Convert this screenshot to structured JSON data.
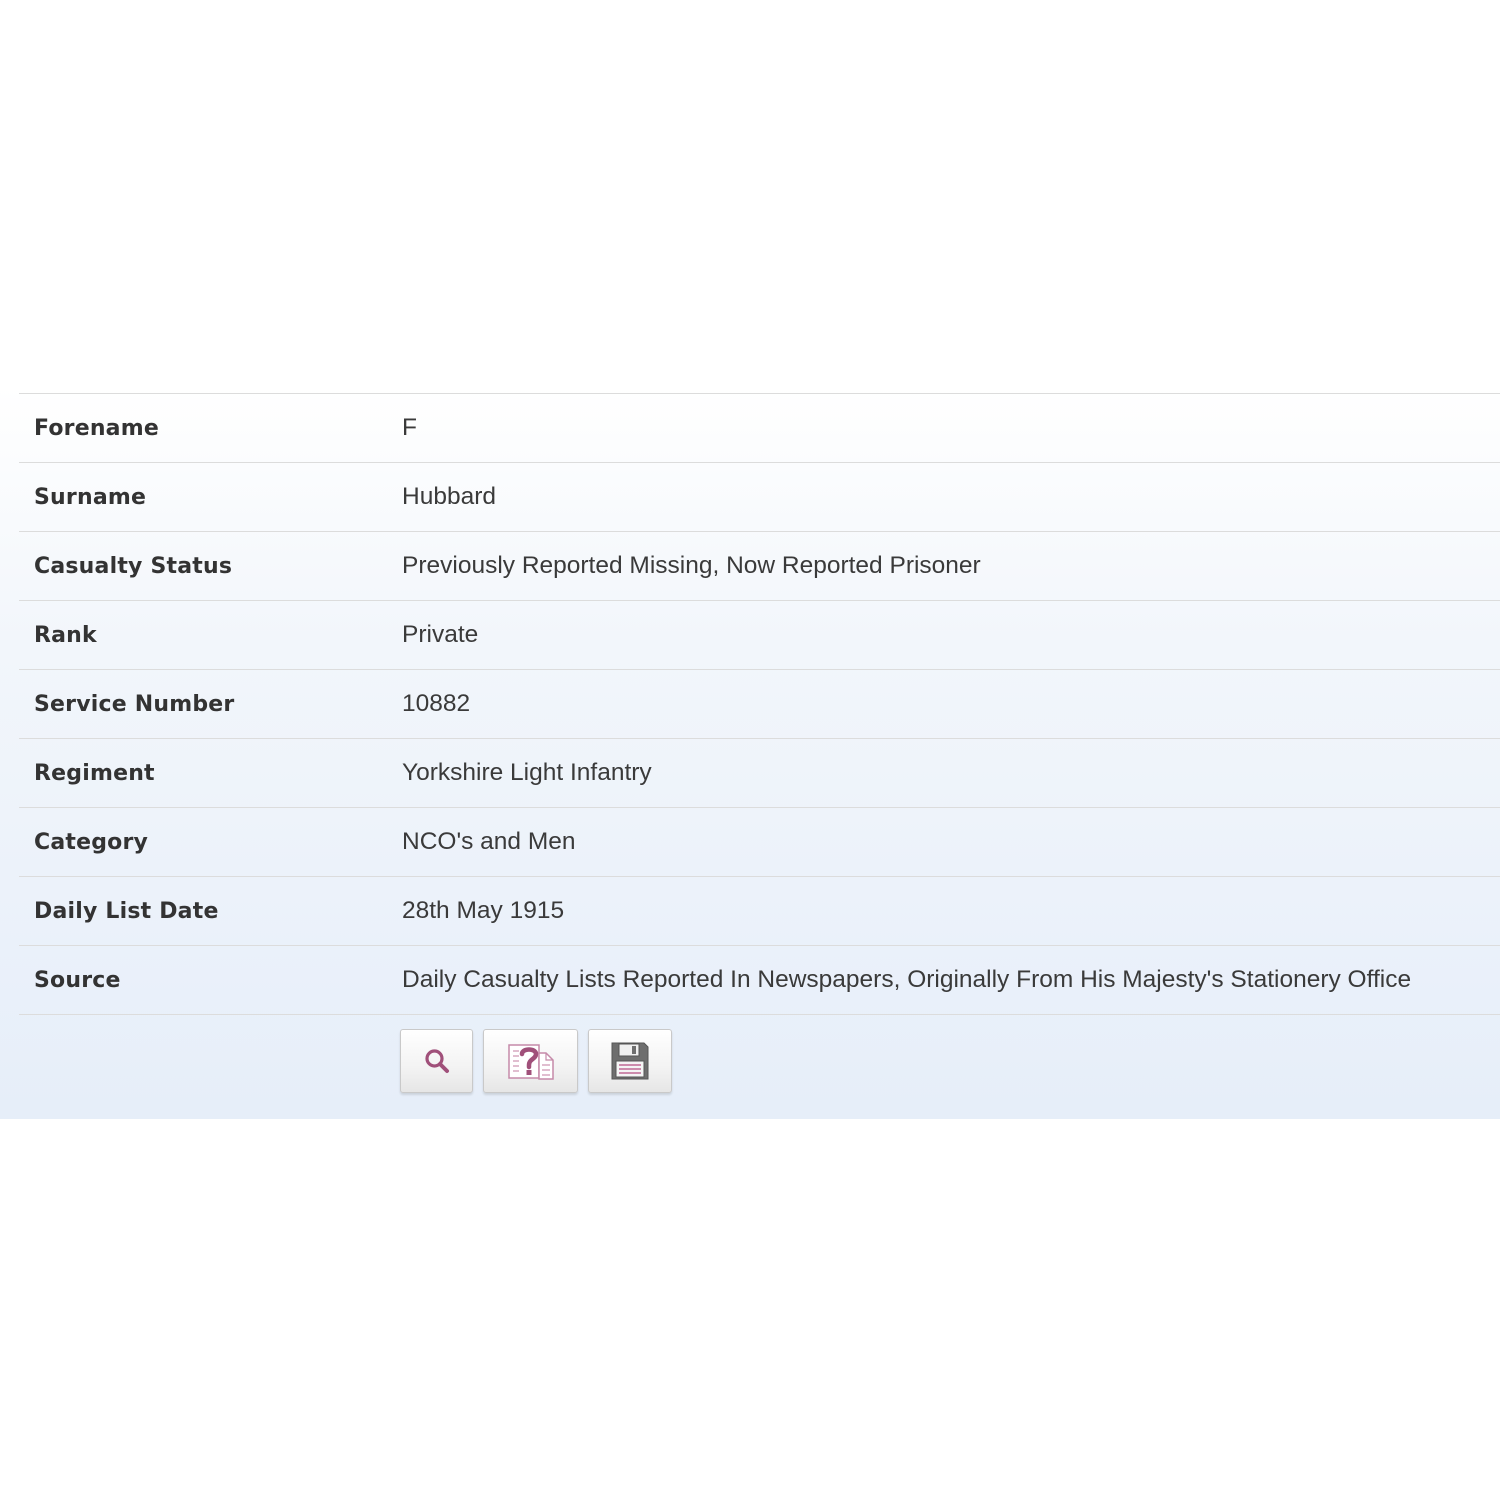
{
  "record": {
    "rows": [
      {
        "label": "Forename",
        "value": "F"
      },
      {
        "label": "Surname",
        "value": "Hubbard"
      },
      {
        "label": "Casualty Status",
        "value": "Previously Reported Missing, Now Reported Prisoner"
      },
      {
        "label": "Rank",
        "value": "Private"
      },
      {
        "label": "Service Number",
        "value": "10882"
      },
      {
        "label": "Regiment",
        "value": "Yorkshire Light Infantry"
      },
      {
        "label": "Category",
        "value": "NCO's and Men"
      },
      {
        "label": "Daily List Date",
        "value": "28th May 1915"
      },
      {
        "label": "Source",
        "value": "Daily Casualty Lists Reported In Newspapers, Originally From His Majesty's Stationery Office"
      }
    ]
  },
  "actions": {
    "search_icon": "search-icon",
    "query_icon": "query-document-icon",
    "save_icon": "save-icon"
  },
  "colors": {
    "accent": "#a0507a",
    "label_text": "#333333",
    "value_text": "#3a3a3a",
    "divider": "#dcdcdc"
  }
}
